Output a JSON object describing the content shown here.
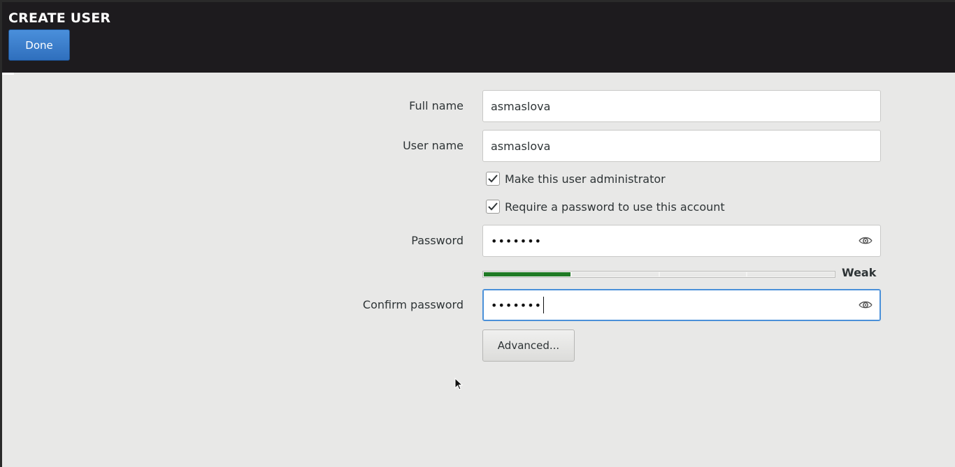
{
  "header": {
    "title": "CREATE USER",
    "done_label": "Done",
    "done_color": "#3a7fd0"
  },
  "form": {
    "full_name_label": "Full name",
    "full_name_value": "asmaslova",
    "user_name_label": "User name",
    "user_name_value": "asmaslova",
    "admin_checkbox_label": "Make this user administrator",
    "admin_checked": true,
    "require_password_label": "Require a password to use this account",
    "require_password_checked": true,
    "password_label": "Password",
    "password_masked": "•••••••",
    "strength_label": "Weak",
    "strength_level": 0.25,
    "strength_color": "#1f7a24",
    "confirm_label": "Confirm password",
    "confirm_masked": "•••••••",
    "advanced_label": "Advanced..."
  },
  "icons": {
    "reveal": "eye-icon",
    "check": "checkmark-icon",
    "pointer": "mouse-pointer-icon"
  }
}
